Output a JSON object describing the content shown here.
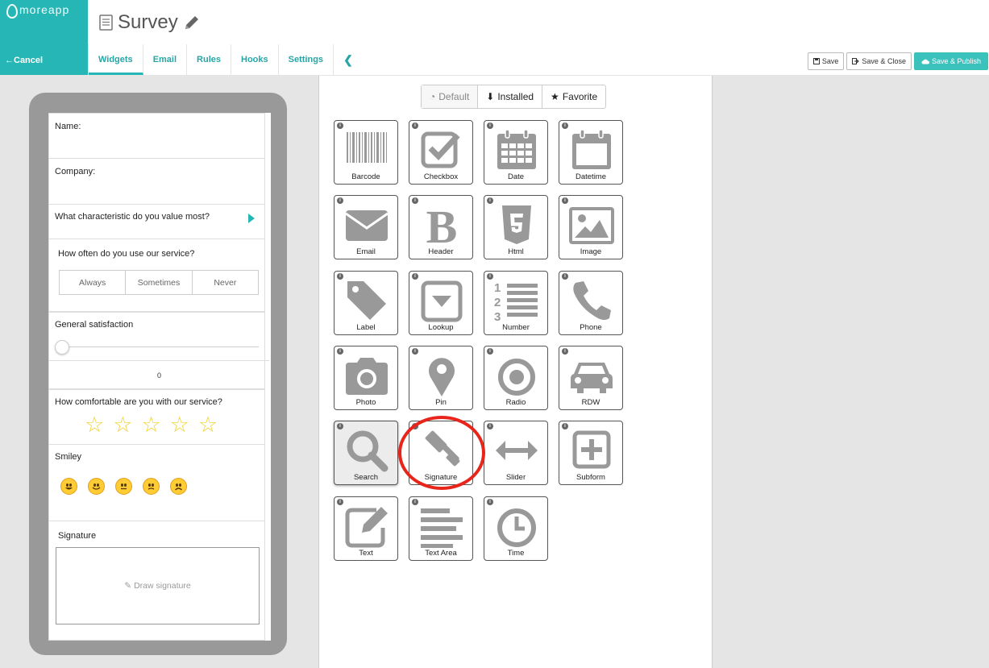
{
  "app": {
    "logo_text": "moreapp",
    "cancel_label": "Cancel"
  },
  "form": {
    "title": "Survey"
  },
  "tabs": [
    {
      "label": "Widgets"
    },
    {
      "label": "Email"
    },
    {
      "label": "Rules"
    },
    {
      "label": "Hooks"
    },
    {
      "label": "Settings"
    }
  ],
  "actions": {
    "save": "Save",
    "save_close": "Save & Close",
    "save_publish": "Save & Publish"
  },
  "preview": {
    "name_label": "Name:",
    "company_label": "Company:",
    "characteristic_label": "What characteristic do you value most?",
    "frequency_label": "How often do you use our service?",
    "frequency_options": [
      "Always",
      "Sometimes",
      "Never"
    ],
    "satisfaction_label": "General satisfaction",
    "satisfaction_value": "0",
    "comfort_label": "How comfortable are you with our service?",
    "smiley_label": "Smiley",
    "signature_label": "Signature",
    "draw_signature": "Draw signature"
  },
  "palette": {
    "categories": [
      {
        "label": "Default"
      },
      {
        "label": "Installed"
      },
      {
        "label": "Favorite"
      }
    ],
    "widgets": [
      {
        "label": "Barcode",
        "icon": "barcode-icon"
      },
      {
        "label": "Checkbox",
        "icon": "checkbox-icon"
      },
      {
        "label": "Date",
        "icon": "calendar-grid-icon"
      },
      {
        "label": "Datetime",
        "icon": "calendar-icon"
      },
      {
        "label": "Email",
        "icon": "envelope-icon"
      },
      {
        "label": "Header",
        "icon": "bold-b-icon"
      },
      {
        "label": "Html",
        "icon": "html5-icon"
      },
      {
        "label": "Image",
        "icon": "image-icon"
      },
      {
        "label": "Label",
        "icon": "tag-icon"
      },
      {
        "label": "Lookup",
        "icon": "dropdown-box-icon"
      },
      {
        "label": "Number",
        "icon": "numbered-list-icon"
      },
      {
        "label": "Phone",
        "icon": "phone-icon"
      },
      {
        "label": "Photo",
        "icon": "camera-icon"
      },
      {
        "label": "Pin",
        "icon": "map-pin-icon"
      },
      {
        "label": "Radio",
        "icon": "radio-target-icon"
      },
      {
        "label": "RDW",
        "icon": "car-icon"
      },
      {
        "label": "Search",
        "icon": "search-icon"
      },
      {
        "label": "Signature",
        "icon": "gavel-icon"
      },
      {
        "label": "Slider",
        "icon": "horizontal-arrows-icon"
      },
      {
        "label": "Subform",
        "icon": "plus-square-icon"
      },
      {
        "label": "Text",
        "icon": "pencil-square-icon"
      },
      {
        "label": "Text Area",
        "icon": "text-lines-icon"
      },
      {
        "label": "Time",
        "icon": "clock-icon"
      }
    ]
  },
  "colors": {
    "brand": "#26b6b6",
    "highlight": "#e8251b",
    "icon": "#999999"
  }
}
